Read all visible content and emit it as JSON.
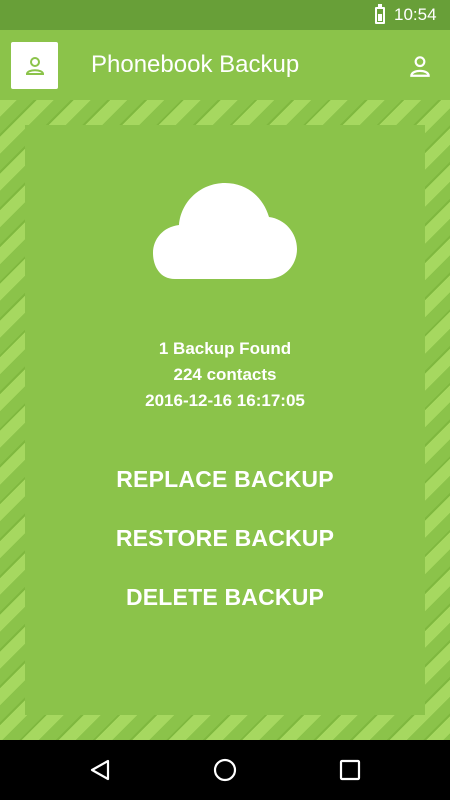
{
  "status_bar": {
    "time": "10:54",
    "battery_icon": "battery-icon"
  },
  "app_bar": {
    "title": "Phonebook Backup",
    "left_icon": "person-icon",
    "right_icon": "account-icon"
  },
  "backup_info": {
    "found": "1 Backup Found",
    "contacts": "224 contacts",
    "timestamp": "2016-12-16 16:17:05"
  },
  "actions": {
    "replace": "REPLACE BACKUP",
    "restore": "RESTORE BACKUP",
    "delete": "DELETE BACKUP"
  },
  "nav_bar": {
    "back_icon": "back-icon",
    "home_icon": "home-icon",
    "recents_icon": "recents-icon"
  },
  "colors": {
    "primary": "#8bc34a",
    "dark": "#689f38",
    "stripe": "#a6d860"
  }
}
